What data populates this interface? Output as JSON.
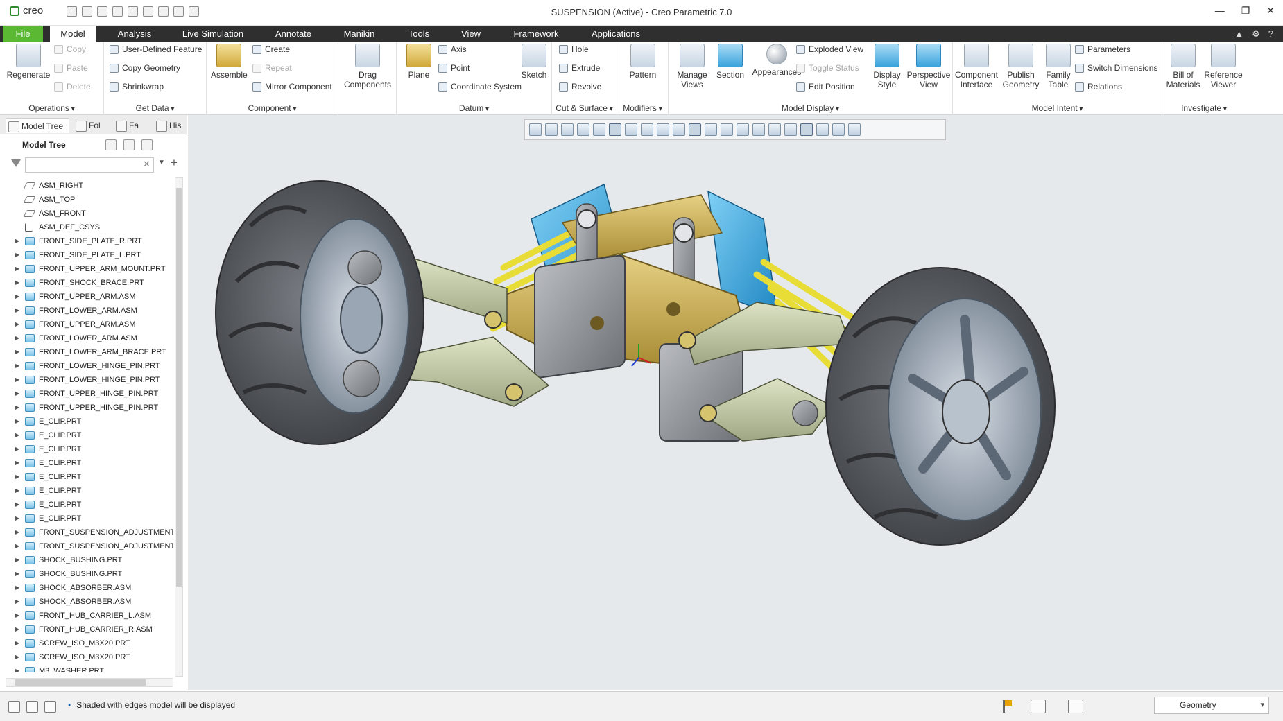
{
  "app": {
    "logo_text": "creo",
    "window_title": "SUSPENSION (Active) - Creo Parametric 7.0",
    "window_controls": [
      "—",
      "❐",
      "✕"
    ]
  },
  "quick_access": [
    "new-icon",
    "open-icon",
    "save-icon",
    "undo-icon",
    "redo-icon",
    "regenerate-icon",
    "windows-icon",
    "close-window-icon",
    "customize-icon"
  ],
  "tabs": {
    "file": "File",
    "items": [
      "Model",
      "Analysis",
      "Live Simulation",
      "Annotate",
      "Manikin",
      "Tools",
      "View",
      "Framework",
      "Applications"
    ],
    "active": "Model",
    "right_icons": [
      "▲",
      "⚙",
      "?"
    ]
  },
  "ribbon": {
    "groups": {
      "operations": "Operations",
      "get_data": "Get Data",
      "component": "Component",
      "datum": "Datum",
      "cut_surface": "Cut & Surface",
      "modifiers": "Modifiers",
      "model_display": "Model Display",
      "model_intent": "Model Intent",
      "investigate": "Investigate"
    },
    "regenerate": "Regenerate",
    "copy": "Copy",
    "paste": "Paste",
    "delete": "Delete",
    "user_defined_feature": "User-Defined Feature",
    "copy_geometry": "Copy Geometry",
    "shrinkwrap": "Shrinkwrap",
    "assemble": "Assemble",
    "create": "Create",
    "repeat": "Repeat",
    "mirror_component": "Mirror Component",
    "drag_components_1": "Drag",
    "drag_components_2": "Components",
    "plane": "Plane",
    "axis": "Axis",
    "point": "Point",
    "coordinate_system": "Coordinate System",
    "sketch": "Sketch",
    "hole": "Hole",
    "extrude": "Extrude",
    "revolve": "Revolve",
    "pattern": "Pattern",
    "manage_views_1": "Manage",
    "manage_views_2": "Views",
    "section": "Section",
    "appearances": "Appearances",
    "exploded_view": "Exploded View",
    "toggle_status": "Toggle Status",
    "edit_position": "Edit Position",
    "display_style_1": "Display",
    "display_style_2": "Style",
    "perspective_view_1": "Perspective",
    "perspective_view_2": "View",
    "component_interface_1": "Component",
    "component_interface_2": "Interface",
    "publish_geometry_1": "Publish",
    "publish_geometry_2": "Geometry",
    "family_table_1": "Family",
    "family_table_2": "Table",
    "parameters": "Parameters",
    "switch_dimensions": "Switch Dimensions",
    "relations": "Relations",
    "bill_of_materials_1": "Bill of",
    "bill_of_materials_2": "Materials",
    "reference_viewer_1": "Reference",
    "reference_viewer_2": "Viewer"
  },
  "panel": {
    "tabs": [
      "Model Tree",
      "Fol",
      "Fa",
      "His"
    ],
    "tree_title": "Model Tree",
    "filter_value": "",
    "nodes": [
      {
        "label": "ASM_RIGHT",
        "kind": "datum"
      },
      {
        "label": "ASM_TOP",
        "kind": "datum"
      },
      {
        "label": "ASM_FRONT",
        "kind": "datum"
      },
      {
        "label": "ASM_DEF_CSYS",
        "kind": "csys"
      },
      {
        "label": "FRONT_SIDE_PLATE_R.PRT",
        "kind": "part"
      },
      {
        "label": "FRONT_SIDE_PLATE_L.PRT",
        "kind": "part"
      },
      {
        "label": "FRONT_UPPER_ARM_MOUNT.PRT",
        "kind": "part"
      },
      {
        "label": "FRONT_SHOCK_BRACE.PRT",
        "kind": "part"
      },
      {
        "label": "FRONT_UPPER_ARM.ASM",
        "kind": "asm"
      },
      {
        "label": "FRONT_LOWER_ARM.ASM",
        "kind": "asm"
      },
      {
        "label": "FRONT_UPPER_ARM.ASM",
        "kind": "asm"
      },
      {
        "label": "FRONT_LOWER_ARM.ASM",
        "kind": "asm"
      },
      {
        "label": "FRONT_LOWER_ARM_BRACE.PRT",
        "kind": "part"
      },
      {
        "label": "FRONT_LOWER_HINGE_PIN.PRT",
        "kind": "part"
      },
      {
        "label": "FRONT_LOWER_HINGE_PIN.PRT",
        "kind": "part"
      },
      {
        "label": "FRONT_UPPER_HINGE_PIN.PRT",
        "kind": "part"
      },
      {
        "label": "FRONT_UPPER_HINGE_PIN.PRT",
        "kind": "part"
      },
      {
        "label": "E_CLIP.PRT",
        "kind": "part"
      },
      {
        "label": "E_CLIP.PRT",
        "kind": "part"
      },
      {
        "label": "E_CLIP.PRT",
        "kind": "part"
      },
      {
        "label": "E_CLIP.PRT",
        "kind": "part"
      },
      {
        "label": "E_CLIP.PRT",
        "kind": "part"
      },
      {
        "label": "E_CLIP.PRT",
        "kind": "part"
      },
      {
        "label": "E_CLIP.PRT",
        "kind": "part"
      },
      {
        "label": "E_CLIP.PRT",
        "kind": "part"
      },
      {
        "label": "FRONT_SUSPENSION_ADJUSTMENT_",
        "kind": "part"
      },
      {
        "label": "FRONT_SUSPENSION_ADJUSTMENT_",
        "kind": "part"
      },
      {
        "label": "SHOCK_BUSHING.PRT",
        "kind": "part"
      },
      {
        "label": "SHOCK_BUSHING.PRT",
        "kind": "part"
      },
      {
        "label": "SHOCK_ABSORBER.ASM",
        "kind": "asm"
      },
      {
        "label": "SHOCK_ABSORBER.ASM",
        "kind": "asm"
      },
      {
        "label": "FRONT_HUB_CARRIER_L.ASM",
        "kind": "asm"
      },
      {
        "label": "FRONT_HUB_CARRIER_R.ASM",
        "kind": "asm"
      },
      {
        "label": "SCREW_ISO_M3X20.PRT",
        "kind": "part"
      },
      {
        "label": "SCREW_ISO_M3X20.PRT",
        "kind": "part"
      },
      {
        "label": "M3_WASHER.PRT",
        "kind": "part"
      }
    ]
  },
  "graphics_toolbar": [
    "refit-icon",
    "zoom-in-icon",
    "zoom-out-icon",
    "repaint-icon",
    "saved-orientations-icon",
    "display-style-icon",
    "view-manager-icon",
    "perspective-icon",
    "datum-display-icon",
    "annotation-display-icon",
    "spin-center-icon",
    "plane-display-icon",
    "axis-display-icon",
    "point-display-icon",
    "csys-display-icon",
    "tag-display-icon",
    "feature-display-icon",
    "model-display-icon",
    "simulation-icon",
    "pause-icon",
    "stop-icon"
  ],
  "colors": {
    "tab_bar": "#2f2f2f",
    "file_tab": "#5ab832",
    "viewport_bg": "#e6e9ec",
    "tire": "#595c61",
    "arm": "#c7d0a6",
    "chassis": "#c9b25a",
    "shock": "#3fa9e0",
    "spring": "#e8dc36",
    "rim": "#9aa6b4"
  },
  "status": {
    "message": "Shaded with edges model will be displayed",
    "selection_filter": "Geometry"
  }
}
